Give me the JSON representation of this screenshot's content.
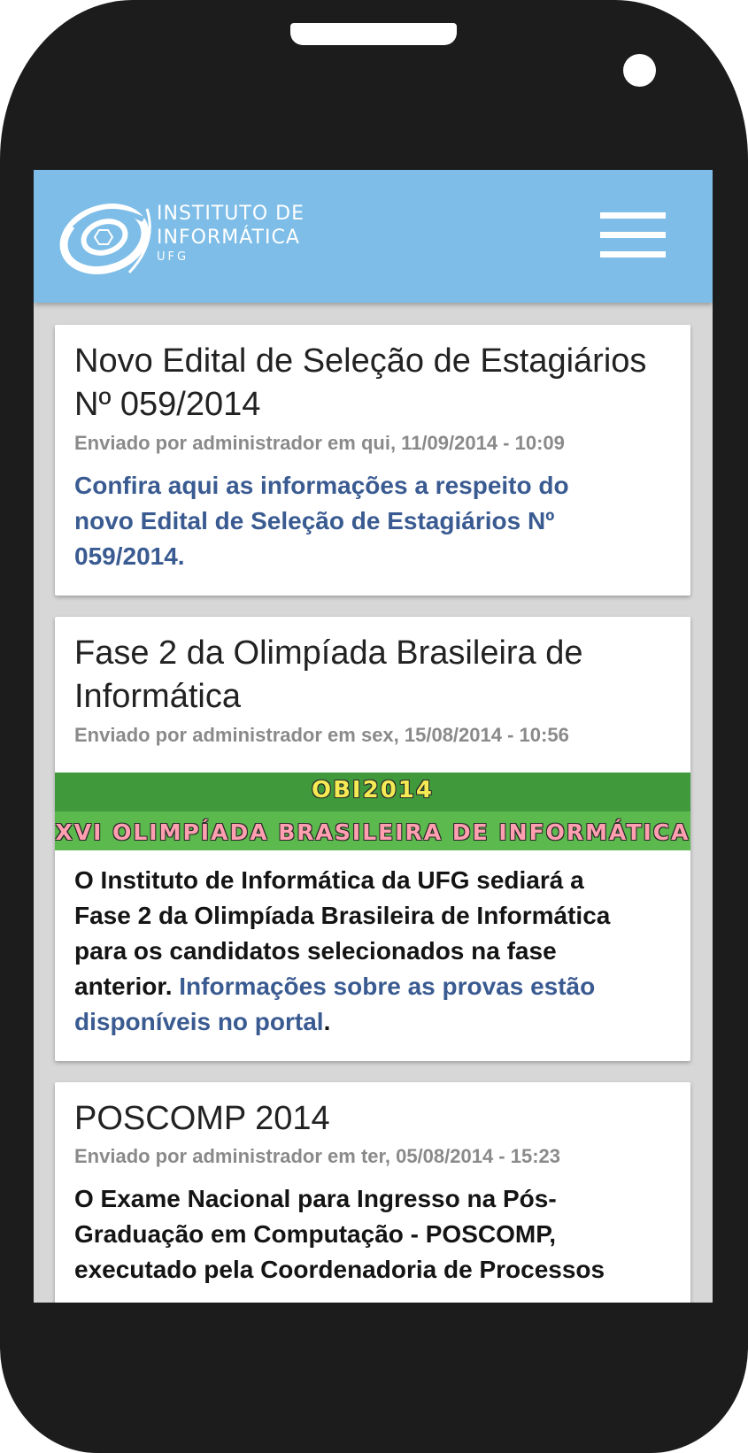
{
  "header": {
    "logo_line1": "INSTITUTO DE",
    "logo_line2": "INFORMÁTICA",
    "logo_line3": "UFG",
    "menu_icon": "hamburger-menu-icon",
    "background_color": "#7dbde7"
  },
  "posts": [
    {
      "title": "Novo Edital de Seleção de Estagiários Nº 059/2014",
      "meta": "Enviado por administrador em qui, 11/09/2014 - 10:09",
      "body_link": "Confira aqui as informações a respeito do novo Edital de Seleção de Estagiários Nº 059/2014."
    },
    {
      "title": "Fase 2 da Olimpíada Brasileira de Informática",
      "meta": "Enviado por administrador em sex, 15/08/2014 - 10:56",
      "banner_title": "OBI2014",
      "banner_subtitle": "XVI OLIMPÍADA BRASILEIRA DE INFORMÁTICA",
      "body_text": "O Instituto de Informática da UFG sediará a Fase 2 da Olimpíada Brasileira de Informática para os candidatos selecionados na fase anterior. ",
      "body_link": "Informações sobre as provas estão disponíveis no portal",
      "body_end": "."
    },
    {
      "title": "POSCOMP 2014",
      "meta": "Enviado por administrador em ter, 05/08/2014 - 15:23",
      "body_text": "O Exame Nacional para Ingresso na Pós-Graduação em Computação - POSCOMP, executado pela Coordenadoria de Processos"
    }
  ],
  "colors": {
    "link": "#3a5b91",
    "meta": "#8a8a8a",
    "phone_body": "#1c1c1c"
  }
}
